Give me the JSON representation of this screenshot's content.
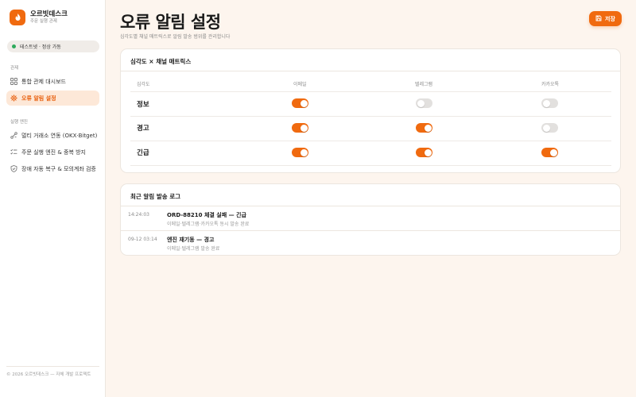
{
  "brand": {
    "name": "오르빗데스크",
    "subtitle": "주문 실행 관제"
  },
  "environment": {
    "label": "테스트넷 · 정상 가동",
    "status_color": "#2eaa5c"
  },
  "sidebar": {
    "sections": [
      {
        "label": "관제",
        "items": [
          {
            "label": "통합 관제 대시보드",
            "icon": "grid-icon",
            "active": false
          },
          {
            "label": "오류 알림 설정",
            "icon": "alert-gear-icon",
            "active": true
          }
        ]
      },
      {
        "label": "실행 엔진",
        "items": [
          {
            "label": "멀티 거래소 연동 (OKX·Bitget)",
            "icon": "link-nodes-icon",
            "active": false
          },
          {
            "label": "주문 실행 엔진 & 중복 방지",
            "icon": "checklist-icon",
            "active": false
          },
          {
            "label": "장애 자동 복구 & 모의계좌 검증",
            "icon": "shield-check-icon",
            "active": false
          }
        ]
      }
    ],
    "footer": "© 2026 오르빗데스크 — 자체 개발 프로젝트"
  },
  "header": {
    "title": "오류 알림 설정",
    "subtitle": "심각도별 채널 매트릭스로 알림 발송 범위를 관리합니다",
    "save_label": "저장"
  },
  "matrix": {
    "title": "심각도 × 채널 매트릭스",
    "col_severity": "심각도",
    "channels": [
      "이메일",
      "텔레그램",
      "카카오톡"
    ],
    "rows": [
      {
        "label": "정보",
        "values": [
          true,
          false,
          false
        ]
      },
      {
        "label": "경고",
        "values": [
          true,
          true,
          false
        ]
      },
      {
        "label": "긴급",
        "values": [
          true,
          true,
          true
        ]
      }
    ]
  },
  "log": {
    "title": "최근 알림 발송 로그",
    "entries": [
      {
        "time": "14:24:03",
        "title": "ORD-88210 체결 실패 — 긴급",
        "desc": "이메일·텔레그램·카카오톡 동시 발송 완료"
      },
      {
        "time": "09-12 03:14",
        "title": "엔진 재기동 — 경고",
        "desc": "이메일·텔레그램 발송 완료"
      }
    ]
  },
  "colors": {
    "accent": "#f06a0f",
    "active_bg": "#fde8d8",
    "page_bg": "#fdf5ee"
  }
}
